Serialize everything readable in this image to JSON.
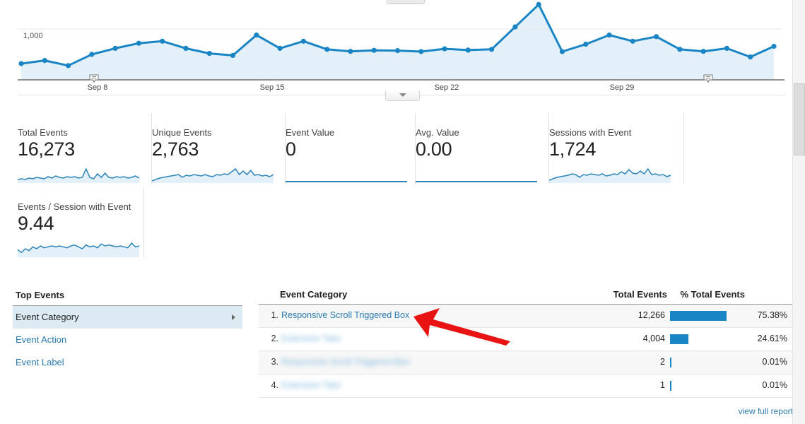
{
  "chart": {
    "collapse_top_icon": "chevron-down-icon",
    "collapse_bottom_icon": "chevron-down-icon",
    "y_axis_label": "1,000",
    "x_ticks": [
      "Sep 8",
      "Sep 15",
      "Sep 22",
      "Sep 29"
    ],
    "annotation_icon": "annotation-marker-icon",
    "line_color": "#1a85c4",
    "fill_color": "#e3f0f9"
  },
  "chart_data": {
    "type": "line",
    "title": "",
    "xlabel": "",
    "ylabel": "",
    "ylim": [
      0,
      1500
    ],
    "gridline_values": [
      1000
    ],
    "x_tick_labels": [
      "Sep 8",
      "Sep 15",
      "Sep 22",
      "Sep 29"
    ],
    "x_tick_indices": [
      3,
      10,
      17,
      24
    ],
    "annotations": [
      {
        "label": "annotation-marker",
        "x_index": 3
      },
      {
        "label": "annotation-marker",
        "x_index": 28
      }
    ],
    "values": [
      320,
      380,
      280,
      500,
      620,
      720,
      760,
      620,
      520,
      480,
      880,
      620,
      760,
      600,
      560,
      580,
      575,
      555,
      610,
      585,
      600,
      1040,
      1480,
      555,
      700,
      880,
      760,
      850,
      600,
      560,
      620,
      450,
      660
    ]
  },
  "metrics": [
    {
      "label": "Total Events",
      "value": "16,273",
      "spark": [
        5,
        6,
        5,
        7,
        6,
        8,
        7,
        6,
        9,
        7,
        10,
        8,
        7,
        9,
        8,
        9,
        7,
        8,
        20,
        8,
        6,
        13,
        8,
        14,
        8,
        7,
        9,
        8,
        9,
        7,
        8,
        10,
        7
      ]
    },
    {
      "label": "Unique Events",
      "value": "2,763",
      "spark": [
        3,
        5,
        7,
        8,
        9,
        10,
        11,
        12,
        8,
        11,
        10,
        12,
        11,
        10,
        12,
        10,
        9,
        12,
        11,
        13,
        12,
        16,
        20,
        12,
        17,
        12,
        18,
        11,
        12,
        10,
        11,
        9,
        12
      ]
    },
    {
      "label": "Event Value",
      "value": "0",
      "spark": []
    },
    {
      "label": "Avg. Value",
      "value": "0.00",
      "spark": []
    },
    {
      "label": "Sessions with Event",
      "value": "1,724",
      "spark": [
        4,
        6,
        8,
        9,
        10,
        11,
        13,
        12,
        8,
        12,
        11,
        13,
        12,
        11,
        13,
        10,
        11,
        13,
        12,
        16,
        13,
        19,
        14,
        13,
        17,
        13,
        20,
        12,
        13,
        11,
        12,
        9,
        11
      ]
    },
    {
      "label": "Events / Session with Event",
      "value": "9.44",
      "spark": [
        8,
        5,
        9,
        7,
        11,
        9,
        12,
        10,
        11,
        12,
        11,
        12,
        11,
        10,
        12,
        13,
        11,
        9,
        13,
        11,
        12,
        10,
        14,
        12,
        13,
        12,
        11,
        12,
        11,
        10,
        15,
        11,
        12
      ]
    }
  ],
  "top_events": {
    "title": "Top Events",
    "items": [
      {
        "label": "Event Category",
        "active": true,
        "arrow_icon": "chevron-right-icon"
      },
      {
        "label": "Event Action",
        "active": false
      },
      {
        "label": "Event Label",
        "active": false
      }
    ]
  },
  "table": {
    "headers": {
      "dimension": "Event Category",
      "total_events": "Total Events",
      "pct_total_events": "% Total Events"
    },
    "rows": [
      {
        "index": "1.",
        "name": "Responsive Scroll Triggered Box",
        "redacted": false,
        "total": "12,266",
        "pct": "75.38%",
        "bar_pct": 75.38
      },
      {
        "index": "2.",
        "name": "Extension Tabs",
        "redacted": true,
        "total": "4,004",
        "pct": "24.61%",
        "bar_pct": 24.61
      },
      {
        "index": "3.",
        "name": "Responsive Scroll Triggered Box",
        "redacted": true,
        "total": "2",
        "pct": "0.01%",
        "bar_pct": 0.01
      },
      {
        "index": "4.",
        "name": "Extension Tabs",
        "redacted": true,
        "total": "1",
        "pct": "0.01%",
        "bar_pct": 0.01
      }
    ],
    "view_full_report": "view full report",
    "bar_color": "#1a85c4"
  },
  "annotation": {
    "arrow_icon": "red-arrow-pointer",
    "color": "#e81414"
  },
  "scrollbar": {
    "name": "vertical-scrollbar"
  }
}
